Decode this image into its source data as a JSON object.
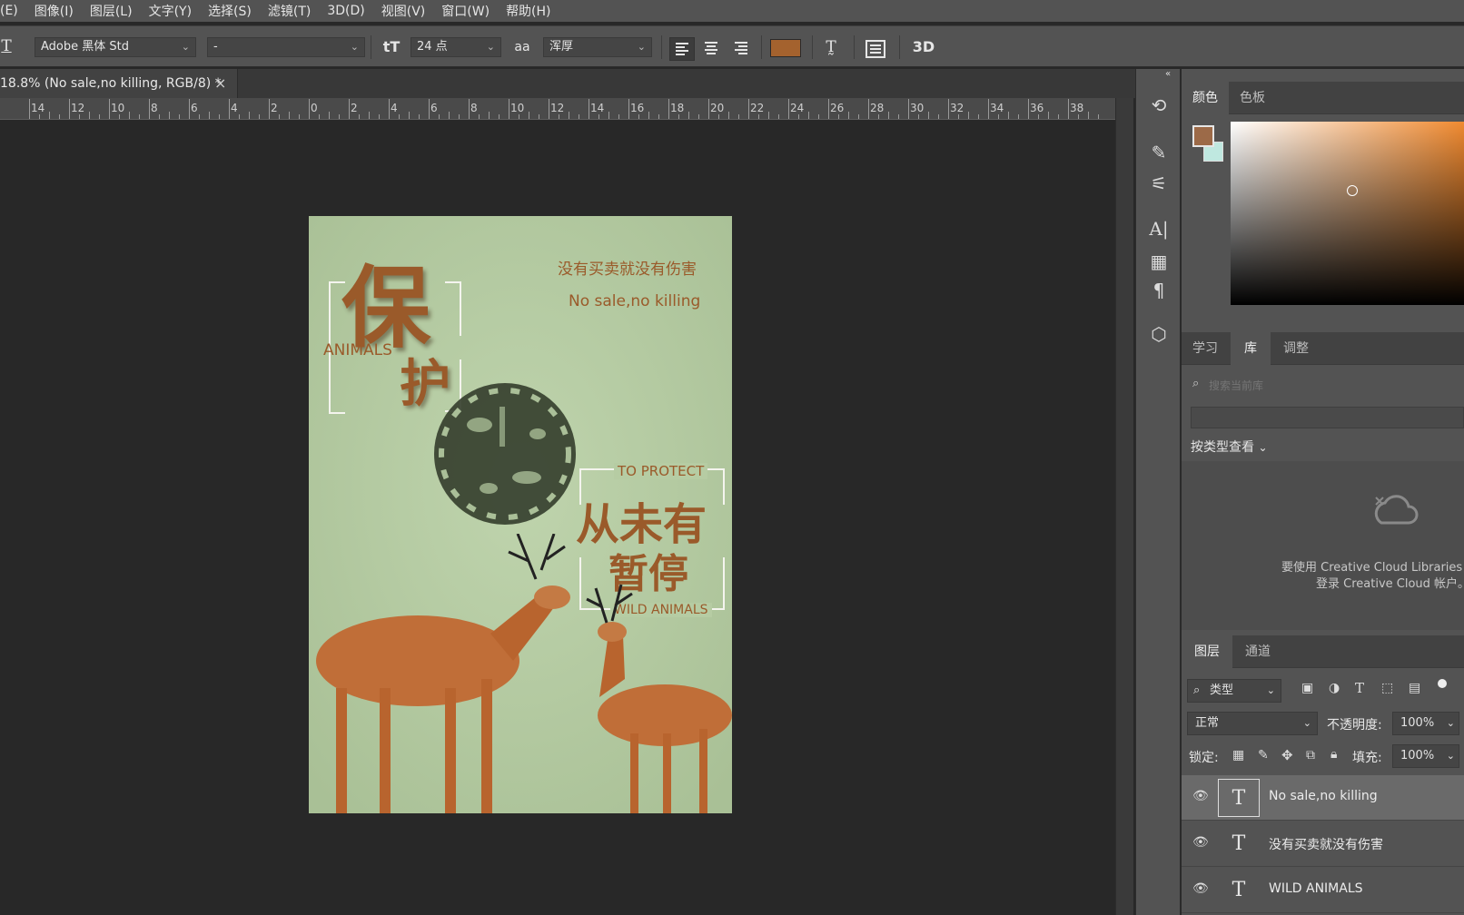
{
  "menu": [
    "(E)",
    "图像(I)",
    "图层(L)",
    "文字(Y)",
    "选择(S)",
    "滤镜(T)",
    "3D(D)",
    "视图(V)",
    "窗口(W)",
    "帮助(H)"
  ],
  "options": {
    "tool_icon": "T",
    "font_family": "Adobe 黑体 Std",
    "font_style": "-",
    "size_icon": "tT",
    "font_size": "24 点",
    "aa_icon": "aa",
    "antialias": "浑厚",
    "align_icons": [
      "align-left-icon",
      "align-center-icon",
      "align-right-icon"
    ],
    "text_color": "#a4622e",
    "threed": "3D"
  },
  "document": {
    "tab_title": "18.8% (No sale,no killing, RGB/8) *",
    "close": "×"
  },
  "ruler": [
    "14",
    "12",
    "10",
    "8",
    "6",
    "4",
    "2",
    "0",
    "2",
    "4",
    "6",
    "8",
    "10",
    "12",
    "14",
    "16",
    "18",
    "20",
    "22",
    "24",
    "26",
    "28",
    "30",
    "32",
    "34",
    "36",
    "38"
  ],
  "poster": {
    "big_char_1": "保",
    "big_char_2": "护",
    "animals": "ANIMALS",
    "tagline_cn": "没有买卖就没有伤害",
    "tagline_en": "No sale,no killing",
    "to_protect": "TO PROTECT",
    "line1": "从未有",
    "line2": "暂停",
    "wild_animals": "WILD ANIMALS",
    "bg_color": "#b6cca3",
    "text_color": "#9a5a2a"
  },
  "color_panel": {
    "tabs": [
      "颜色",
      "色板"
    ],
    "foreground": "#9c6a48",
    "background": "#bfe8e0"
  },
  "library_panel": {
    "tabs": [
      "学习",
      "库",
      "调整"
    ],
    "search_placeholder": "搜索当前库",
    "view_by": "按类型查看",
    "message_line1": "要使用 Creative Cloud Libraries，",
    "message_line2": "登录 Creative Cloud 帐户。"
  },
  "layers_panel": {
    "tabs": [
      "图层",
      "通道"
    ],
    "filter_label": "类型",
    "blend_mode": "正常",
    "opacity_label": "不透明度:",
    "opacity": "100%",
    "lock_label": "锁定:",
    "fill_label": "填充:",
    "fill": "100%",
    "layers": [
      {
        "name": "No sale,no killing",
        "selected": true
      },
      {
        "name": "没有买卖就没有伤害",
        "selected": false
      },
      {
        "name": "WILD ANIMALS",
        "selected": false
      }
    ]
  }
}
